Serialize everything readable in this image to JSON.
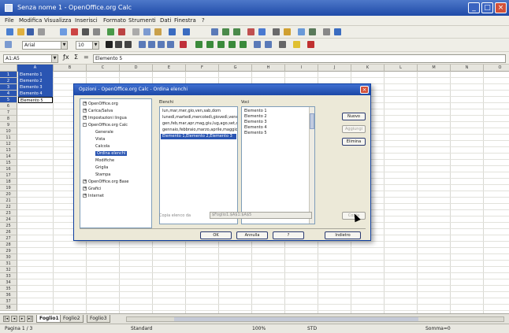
{
  "window": {
    "title": "Senza nome 1 - OpenOffice.org Calc"
  },
  "menubar": [
    "File",
    "Modifica",
    "Visualizza",
    "Inserisci",
    "Formato",
    "Strumenti",
    "Dati",
    "Finestra",
    "?"
  ],
  "formatting": {
    "font": "Arial",
    "size": "10"
  },
  "formula_bar": {
    "cell_ref": "A1:A5",
    "value": "Elemento 5"
  },
  "columns": [
    "A",
    "B",
    "C",
    "D",
    "E",
    "F",
    "G",
    "H",
    "I",
    "J",
    "K",
    "L",
    "M",
    "N",
    "O"
  ],
  "cells": [
    "Elemento 1",
    "Elemento 2",
    "Elemento 3",
    "Elemento 4",
    "Elemento 5"
  ],
  "dialog": {
    "title": "Opzioni - OpenOffice.org Calc - Ordina elenchi",
    "tree": [
      {
        "label": "OpenOffice.org",
        "exp": "+",
        "indent": 0
      },
      {
        "label": "Carica/Salva",
        "exp": "+",
        "indent": 0
      },
      {
        "label": "Impostazioni lingua",
        "exp": "+",
        "indent": 0
      },
      {
        "label": "OpenOffice.org Calc",
        "exp": "-",
        "indent": 0
      },
      {
        "label": "Generale",
        "exp": "",
        "indent": 2
      },
      {
        "label": "Vista",
        "exp": "",
        "indent": 2
      },
      {
        "label": "Calcola",
        "exp": "",
        "indent": 2
      },
      {
        "label": "Ordina elenchi",
        "exp": "",
        "indent": 2,
        "selected": true
      },
      {
        "label": "Modifiche",
        "exp": "",
        "indent": 2
      },
      {
        "label": "Griglia",
        "exp": "",
        "indent": 2
      },
      {
        "label": "Stampa",
        "exp": "",
        "indent": 2
      },
      {
        "label": "OpenOffice.org Base",
        "exp": "+",
        "indent": 0
      },
      {
        "label": "Grafici",
        "exp": "+",
        "indent": 0
      },
      {
        "label": "Internet",
        "exp": "+",
        "indent": 0
      }
    ],
    "lists_label": "Elenchi",
    "lists": [
      "lun,mar,mer,gio,ven,sab,dom",
      "lunedì,martedì,mercoledì,giovedì,venerdì",
      "gen,feb,mar,apr,mag,giu,lug,ago,set,ott",
      "gennaio,febbraio,marzo,aprile,maggio",
      "Elemento 1,Elemento 2,Elemento 3"
    ],
    "entries_label": "Voci",
    "entries": [
      "Elemento 1",
      "Elemento 2",
      "Elemento 3",
      "Elemento 4",
      "Elemento 5"
    ],
    "side_buttons": {
      "new": "Nuovo",
      "add": "Aggiungi",
      "delete": "Elimina"
    },
    "copy_from_label": "Copia elenco da",
    "copy_from_value": "$Foglio1.$A$1:$A$5",
    "copy_button": "Copia",
    "footer_buttons": {
      "ok": "OK",
      "cancel": "Annulla",
      "help": "?",
      "back": "Indietro"
    }
  },
  "sheet_tabs": [
    "Foglio1",
    "Foglio2",
    "Foglio3"
  ],
  "status": {
    "page": "Pagina 1 / 3",
    "style": "Standard",
    "zoom": "100%",
    "mode": "STD",
    "sum": "Somma=0"
  }
}
